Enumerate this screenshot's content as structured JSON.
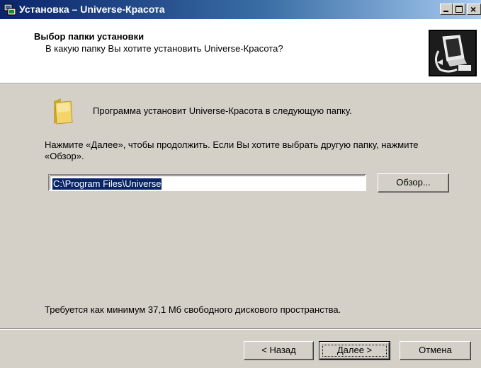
{
  "window": {
    "title": "Установка – Universe-Красота",
    "close_glyph": "×"
  },
  "header": {
    "title": "Выбор папки установки",
    "subtitle": "В какую папку Вы хотите установить Universe-Красота?",
    "logo_icon": "computer-install-icon"
  },
  "body": {
    "folder_icon": "folder-icon",
    "install_line": "Программа установит Universe-Красота в следующую папку.",
    "instruction": "Нажмите «Далее», чтобы продолжить. Если Вы хотите выбрать другую папку, нажмите «Обзор».",
    "path_value": "C:\\Program Files\\Universe",
    "browse_label": "Обзор...",
    "space_required": "Требуется как минимум 37,1 Мб свободного дискового пространства."
  },
  "footer": {
    "back_label": "< Назад",
    "next_label": "Далее >",
    "cancel_label": "Отмена"
  },
  "colors": {
    "titlebar_start": "#0a246a",
    "titlebar_end": "#a6caf0",
    "dialog_bg": "#d4d0c8",
    "selection": "#0a246a"
  }
}
